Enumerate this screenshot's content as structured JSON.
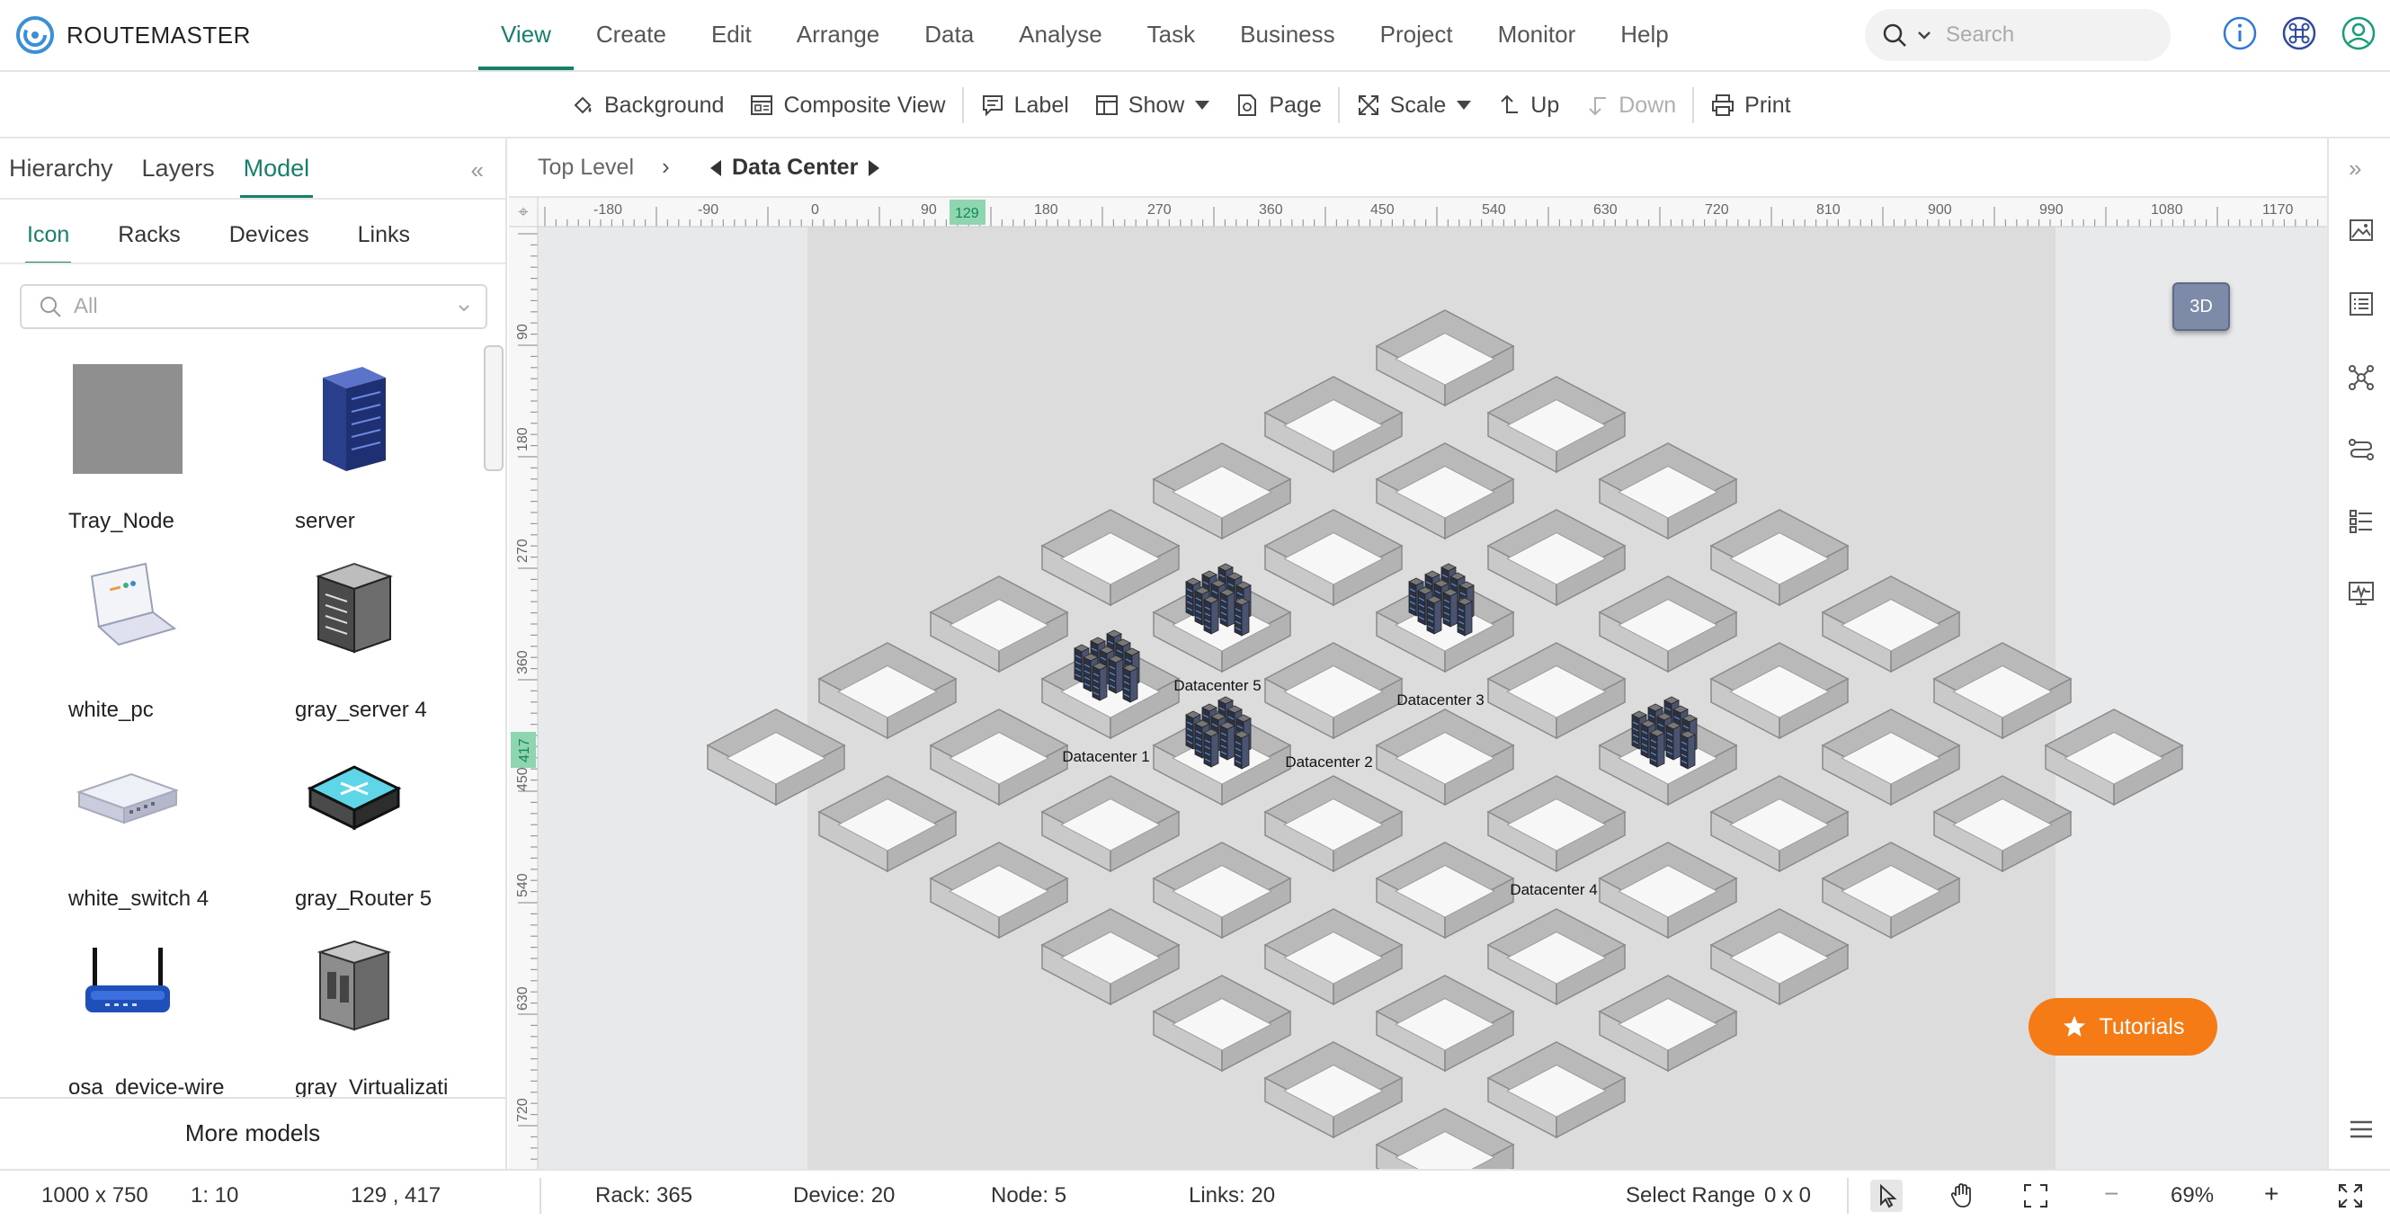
{
  "app": {
    "name": "ROUTEMASTER"
  },
  "menu": [
    "View",
    "Create",
    "Edit",
    "Arrange",
    "Data",
    "Analyse",
    "Task",
    "Business",
    "Project",
    "Monitor",
    "Help"
  ],
  "search": {
    "placeholder": "Search"
  },
  "toolbar": {
    "background": "Background",
    "composite_view": "Composite View",
    "label": "Label",
    "show": "Show",
    "page": "Page",
    "scale": "Scale",
    "up": "Up",
    "down": "Down",
    "print": "Print"
  },
  "left_panel": {
    "tabs": [
      "Hierarchy",
      "Layers",
      "Model"
    ],
    "sub_tabs": [
      "Icon",
      "Racks",
      "Devices",
      "Links"
    ],
    "filter_placeholder": "All",
    "models": [
      "Tray_Node",
      "server",
      "white_pc",
      "gray_server 4",
      "white_switch 4",
      "gray_Router 5",
      "osa_device-wire",
      "gray_Virtualizati"
    ],
    "more_models": "More models",
    "collapse_icon": "double-chevron-left-icon"
  },
  "breadcrumb": {
    "top": "Top Level",
    "separator": "›",
    "current": "Data Center"
  },
  "ruler": {
    "h_labels": [
      "-180",
      "-90",
      "0",
      "90",
      "129",
      "180",
      "270",
      "360",
      "450",
      "540",
      "630",
      "720",
      "810",
      "900",
      "990",
      "1080",
      "1170"
    ],
    "v_labels": [
      "90",
      "180",
      "270",
      "360",
      "417",
      "450",
      "540",
      "630",
      "720"
    ],
    "h_marker": "129",
    "v_marker": "417",
    "marker_color": "#8fd5b0"
  },
  "datacenters": [
    "Datacenter 1",
    "Datacenter 2",
    "Datacenter 3",
    "Datacenter 4",
    "Datacenter 5"
  ],
  "buttons": {
    "three_d": "3D",
    "tutorials": "Tutorials"
  },
  "status": {
    "page_size": "1000 x 750",
    "scale": "1: 10",
    "coords": "129 , 417",
    "rack": "Rack: 365",
    "device": "Device: 20",
    "node": "Node: 5",
    "links": "Links: 20",
    "select_range_label": "Select Range",
    "select_range_value": "0 x 0",
    "zoom": "69%",
    "zoom_minus": "−",
    "zoom_plus": "+"
  },
  "colors": {
    "accent": "#17806d",
    "tutorials": "#f47b16",
    "canvas_bg": "#e6e6e6",
    "page_bg": "#dcdcdc"
  }
}
